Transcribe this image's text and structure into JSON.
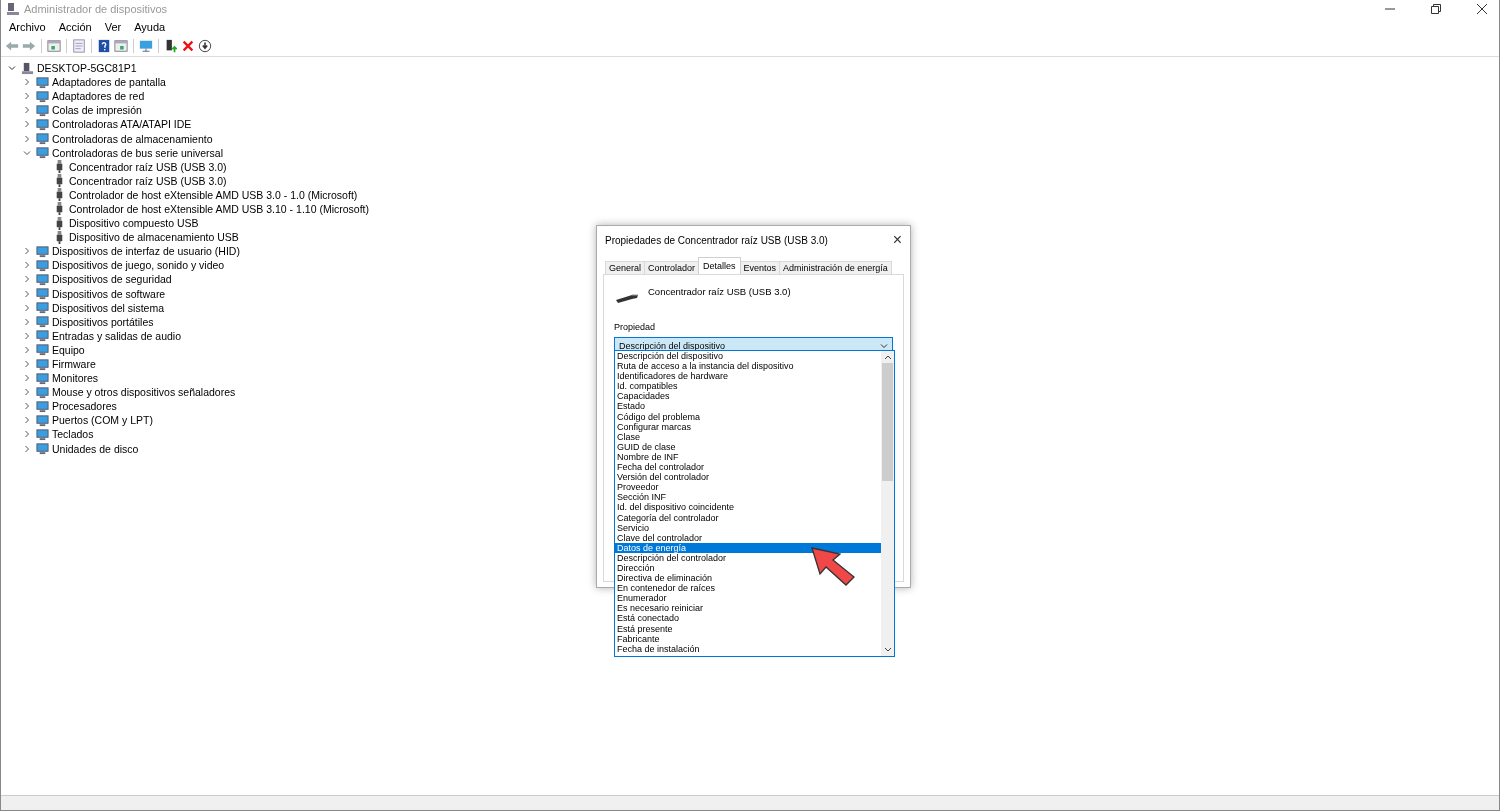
{
  "window": {
    "title": "Administrador de dispositivos"
  },
  "menu": [
    "Archivo",
    "Acción",
    "Ver",
    "Ayuda"
  ],
  "tree": {
    "label": "DESKTOP-5GC81P1",
    "expanded": true,
    "children": [
      {
        "label": "Adaptadores de pantalla",
        "expanded": false
      },
      {
        "label": "Adaptadores de red",
        "expanded": false
      },
      {
        "label": "Colas de impresión",
        "expanded": false
      },
      {
        "label": "Controladoras ATA/ATAPI IDE",
        "expanded": false
      },
      {
        "label": "Controladoras de almacenamiento",
        "expanded": false
      },
      {
        "label": "Controladoras de bus serie universal",
        "expanded": true,
        "children": [
          {
            "label": "Concentrador raíz USB (USB 3.0)"
          },
          {
            "label": "Concentrador raíz USB (USB 3.0)"
          },
          {
            "label": "Controlador de host eXtensible AMD USB 3.0 - 1.0 (Microsoft)"
          },
          {
            "label": "Controlador de host eXtensible AMD USB 3.10 - 1.10 (Microsoft)"
          },
          {
            "label": "Dispositivo compuesto USB"
          },
          {
            "label": "Dispositivo de almacenamiento USB"
          }
        ]
      },
      {
        "label": "Dispositivos de interfaz de usuario (HID)",
        "expanded": false
      },
      {
        "label": "Dispositivos de juego, sonido y video",
        "expanded": false
      },
      {
        "label": "Dispositivos de seguridad",
        "expanded": false
      },
      {
        "label": "Dispositivos de software",
        "expanded": false
      },
      {
        "label": "Dispositivos del sistema",
        "expanded": false
      },
      {
        "label": "Dispositivos portátiles",
        "expanded": false
      },
      {
        "label": "Entradas y salidas de audio",
        "expanded": false
      },
      {
        "label": "Equipo",
        "expanded": false
      },
      {
        "label": "Firmware",
        "expanded": false
      },
      {
        "label": "Monitores",
        "expanded": false
      },
      {
        "label": "Mouse y otros dispositivos señaladores",
        "expanded": false
      },
      {
        "label": "Procesadores",
        "expanded": false
      },
      {
        "label": "Puertos (COM y LPT)",
        "expanded": false
      },
      {
        "label": "Teclados",
        "expanded": false
      },
      {
        "label": "Unidades de disco",
        "expanded": false
      }
    ]
  },
  "dialog": {
    "title": "Propiedades de Concentrador raíz USB (USB 3.0)",
    "close": "×",
    "tabs": [
      {
        "label": "General",
        "selected": false
      },
      {
        "label": "Controlador",
        "selected": false
      },
      {
        "label": "Detalles",
        "selected": true
      },
      {
        "label": "Eventos",
        "selected": false
      },
      {
        "label": "Administración de energía",
        "selected": false
      }
    ],
    "device_name": "Concentrador raíz USB (USB 3.0)",
    "property_label": "Propiedad",
    "property_value": "Descripción del dispositivo",
    "options": [
      {
        "label": "Descripción del dispositivo",
        "selected": false
      },
      {
        "label": "Ruta de acceso a la instancia del dispositivo",
        "selected": false
      },
      {
        "label": "Identificadores de hardware",
        "selected": false
      },
      {
        "label": "Id. compatibles",
        "selected": false
      },
      {
        "label": "Capacidades",
        "selected": false
      },
      {
        "label": "Estado",
        "selected": false
      },
      {
        "label": "Código del problema",
        "selected": false
      },
      {
        "label": "Configurar marcas",
        "selected": false
      },
      {
        "label": "Clase",
        "selected": false
      },
      {
        "label": "GUID de clase",
        "selected": false
      },
      {
        "label": "Nombre de INF",
        "selected": false
      },
      {
        "label": "Fecha del controlador",
        "selected": false
      },
      {
        "label": "Versión del controlador",
        "selected": false
      },
      {
        "label": "Proveedor",
        "selected": false
      },
      {
        "label": "Sección INF",
        "selected": false
      },
      {
        "label": "Id. del dispositivo coincidente",
        "selected": false
      },
      {
        "label": "Categoría del controlador",
        "selected": false
      },
      {
        "label": "Servicio",
        "selected": false
      },
      {
        "label": "Clave del controlador",
        "selected": false
      },
      {
        "label": "Datos de energía",
        "selected": true
      },
      {
        "label": "Descripción del controlador",
        "selected": false
      },
      {
        "label": "Dirección",
        "selected": false
      },
      {
        "label": "Directiva de eliminación",
        "selected": false
      },
      {
        "label": "En contenedor de raíces",
        "selected": false
      },
      {
        "label": "Enumerador",
        "selected": false
      },
      {
        "label": "Es necesario reiniciar",
        "selected": false
      },
      {
        "label": "Está conectado",
        "selected": false
      },
      {
        "label": "Está presente",
        "selected": false
      },
      {
        "label": "Fabricante",
        "selected": false
      },
      {
        "label": "Fecha de instalación",
        "selected": false
      }
    ]
  }
}
